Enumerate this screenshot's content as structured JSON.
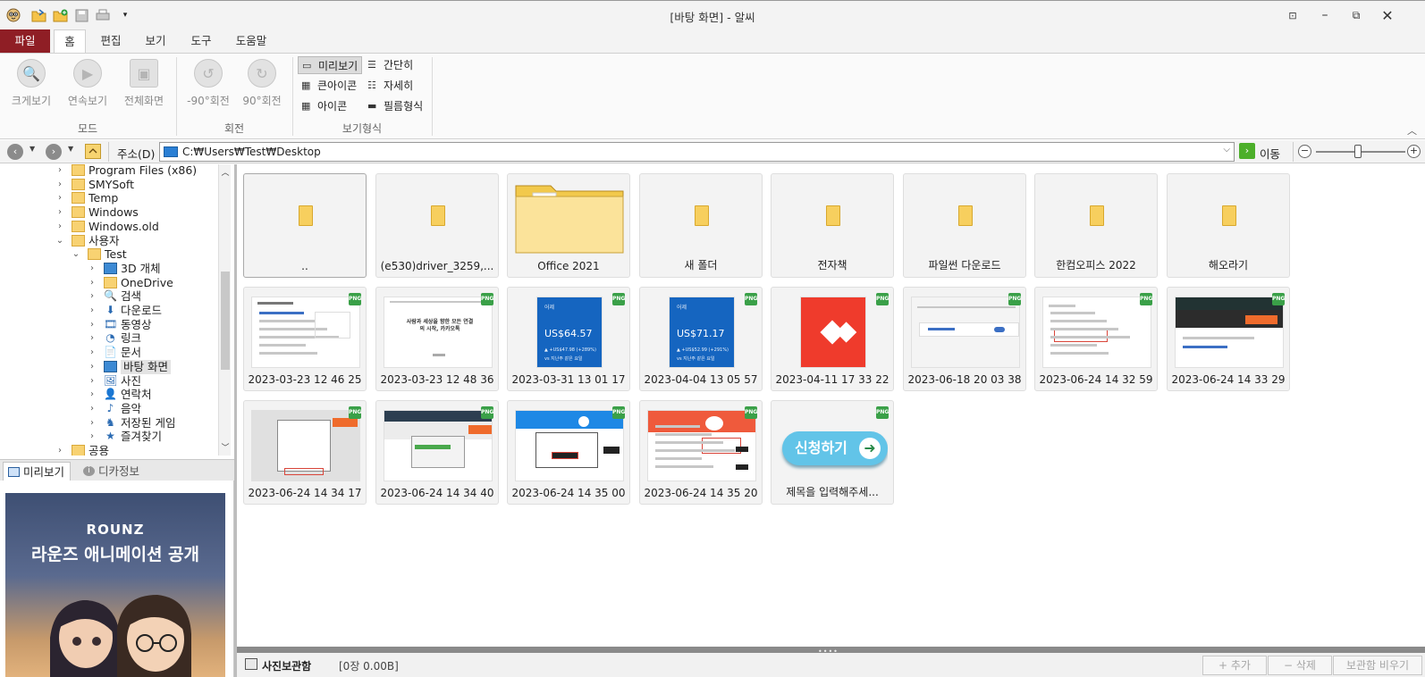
{
  "window": {
    "title": "[바탕 화면] - 알씨",
    "controls": [
      "ribbon-toggle",
      "minimize",
      "restore",
      "close"
    ]
  },
  "quick_access": [
    "app-logo-icon",
    "open-folder-icon",
    "add-folder-icon",
    "save-icon",
    "print-icon",
    "customize-icon"
  ],
  "ribbon": {
    "tabs": [
      "파일",
      "홈",
      "편집",
      "보기",
      "도구",
      "도움말"
    ],
    "active_tab": "홈",
    "groups": {
      "mode": {
        "label": "모드",
        "buttons": [
          "크게보기",
          "연속보기",
          "전체화면"
        ]
      },
      "rotate": {
        "label": "회전",
        "buttons": [
          "-90°회전",
          "90°회전"
        ]
      },
      "view": {
        "label": "보기형식",
        "buttons": [
          "미리보기",
          "간단히",
          "큰아이콘",
          "자세히",
          "아이콘",
          "필름형식"
        ],
        "selected": "미리보기"
      }
    }
  },
  "address": {
    "label": "주소(D)",
    "path": "C:₩Users₩Test₩Desktop",
    "go_label": "이동"
  },
  "tree": {
    "items": [
      {
        "label": "Program Files (x86)",
        "level": 1,
        "expand": ">"
      },
      {
        "label": "SMYSoft",
        "level": 1,
        "expand": ">"
      },
      {
        "label": "Temp",
        "level": 1,
        "expand": ">"
      },
      {
        "label": "Windows",
        "level": 1,
        "expand": ">"
      },
      {
        "label": "Windows.old",
        "level": 1,
        "expand": ">"
      },
      {
        "label": "사용자",
        "level": 1,
        "expand": "v"
      },
      {
        "label": "Test",
        "level": 2,
        "expand": "v"
      },
      {
        "label": "3D 개체",
        "level": 3,
        "expand": ">"
      },
      {
        "label": "OneDrive",
        "level": 3,
        "expand": ">"
      },
      {
        "label": "검색",
        "level": 3,
        "expand": ">"
      },
      {
        "label": "다운로드",
        "level": 3,
        "expand": ">"
      },
      {
        "label": "동영상",
        "level": 3,
        "expand": ">"
      },
      {
        "label": "링크",
        "level": 3,
        "expand": ">"
      },
      {
        "label": "문서",
        "level": 3,
        "expand": ">"
      },
      {
        "label": "바탕 화면",
        "level": 3,
        "expand": ">",
        "selected": true
      },
      {
        "label": "사진",
        "level": 3,
        "expand": ">"
      },
      {
        "label": "연락처",
        "level": 3,
        "expand": ">"
      },
      {
        "label": "음악",
        "level": 3,
        "expand": ">"
      },
      {
        "label": "저장된 게임",
        "level": 3,
        "expand": ">"
      },
      {
        "label": "즐겨찾기",
        "level": 3,
        "expand": ">"
      },
      {
        "label": "공용",
        "level": 1,
        "expand": ">"
      }
    ]
  },
  "preview_panel": {
    "tabs": [
      "미리보기",
      "디카정보"
    ],
    "active_tab": "미리보기",
    "image_text": {
      "brand": "ROUNZ",
      "headline": "라운즈 애니메이션 공개"
    }
  },
  "files": [
    {
      "name": "..",
      "kind": "folder"
    },
    {
      "name": "(e530)driver_3259,...",
      "kind": "folder"
    },
    {
      "name": "Office 2021",
      "kind": "folder-open"
    },
    {
      "name": "새 폴더",
      "kind": "folder"
    },
    {
      "name": "전자책",
      "kind": "folder"
    },
    {
      "name": "파일썬 다운로드",
      "kind": "folder"
    },
    {
      "name": "한컴오피스 2022",
      "kind": "folder"
    },
    {
      "name": "해오라기",
      "kind": "folder"
    },
    {
      "name": "2023-03-23 12 46 25",
      "kind": "png"
    },
    {
      "name": "2023-03-23 12 48 36",
      "kind": "png"
    },
    {
      "name": "2023-03-31 13 01 17",
      "kind": "png",
      "thumb_text": [
        "어제",
        "US$64.57",
        "▲ +US$47.98 (+289%)",
        "vs 지난주 같은 요일"
      ]
    },
    {
      "name": "2023-04-04 13 05 57",
      "kind": "png",
      "thumb_text": [
        "어제",
        "US$71.17",
        "▲ +US$52.99 (+291%)",
        "vs 지난주 같은 요일"
      ]
    },
    {
      "name": "2023-04-11 17 33 22",
      "kind": "png"
    },
    {
      "name": "2023-06-18 20 03 38",
      "kind": "png"
    },
    {
      "name": "2023-06-24 14 32 59",
      "kind": "png"
    },
    {
      "name": "2023-06-24 14 33 29",
      "kind": "png"
    },
    {
      "name": "2023-06-24 14 34 17",
      "kind": "png"
    },
    {
      "name": "2023-06-24 14 34 40",
      "kind": "png"
    },
    {
      "name": "2023-06-24 14 35 00",
      "kind": "png"
    },
    {
      "name": "2023-06-24 14 35 20",
      "kind": "png"
    },
    {
      "name": "제목을 입력해주세...",
      "kind": "png",
      "thumb_text": [
        "신청하기"
      ]
    }
  ],
  "badge": "PNG",
  "thumb_texts": {
    "kakao": "사람과 세상을 향한 모든 연결의 시작, 카카오톡"
  },
  "bottom": {
    "label": "사진보관함",
    "count": "[0장 0.00B]",
    "buttons": [
      "+ 추가",
      "− 삭제",
      "보관함 비우기"
    ]
  },
  "colors": {
    "file_tab": "#8f1e25",
    "folder": "#f7cf5e",
    "png_badge": "#3aa048",
    "google_blue": "#1565c0",
    "anydesk_red": "#ef3b2c",
    "cta": "#62c4e8"
  }
}
